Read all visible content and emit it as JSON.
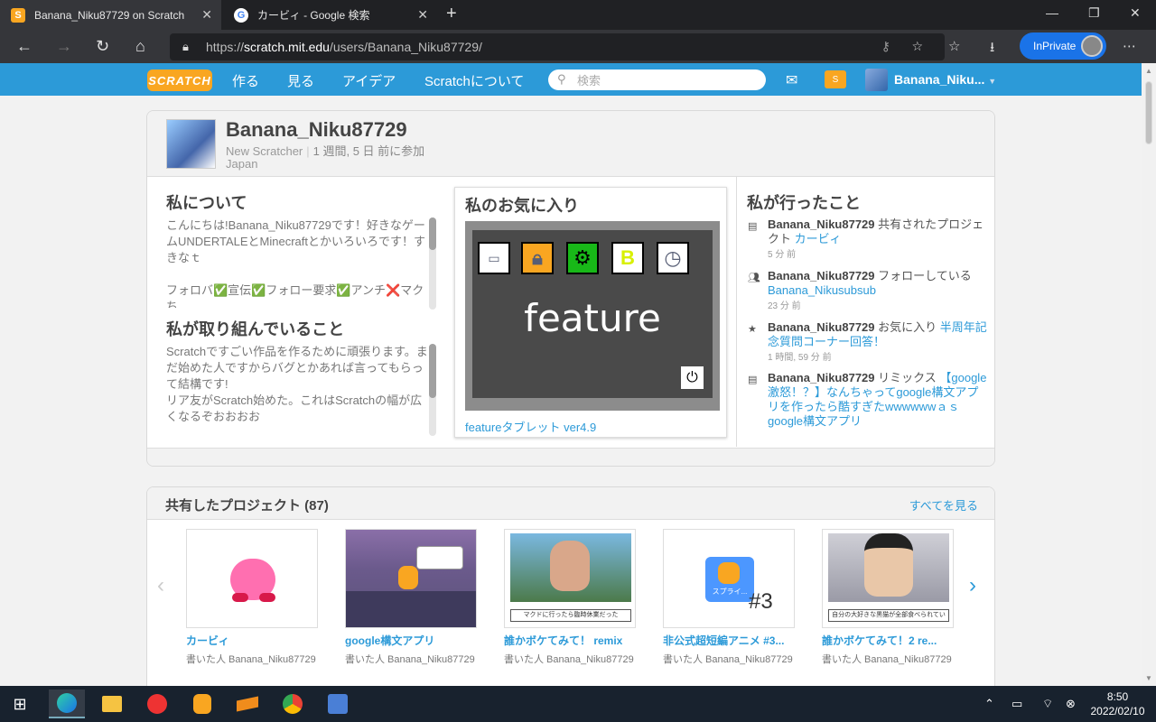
{
  "browser": {
    "tabs": [
      {
        "title": "Banana_Niku87729 on Scratch",
        "active": true
      },
      {
        "title": "カービィ - Google 検索",
        "active": false
      }
    ],
    "url_prefix": "https://",
    "url_host": "scratch.mit.edu",
    "url_path": "/users/Banana_Niku87729/",
    "inprivate_label": "InPrivate"
  },
  "scratch_nav": {
    "logo": "SCRATCH",
    "items": [
      "作る",
      "見る",
      "アイデア",
      "Scratchについて"
    ],
    "search_placeholder": "検索",
    "username": "Banana_Niku..."
  },
  "profile": {
    "username": "Banana_Niku87729",
    "rank": "New Scratcher",
    "joined": "1 週間, 5 日 前に参加",
    "country": "Japan",
    "about_title": "私について",
    "about_text": "こんにちは!Banana_Niku87729です！好きなゲームUNDERTALEとMinecraftとかいろいろです！すきなｔ\n\nフォロバ✅宣伝✅フォロー要求✅アンチ❌マクち",
    "working_title": "私が取り組んでいること",
    "working_text": "Scratchですごい作品を作るために頑張ります。まだ始めた人ですからバグとかあれば言ってもらって結構です!\nリア友がScratch始めた。これはScratchの幅が広くなるぞおおおお",
    "featured_title": "私のお気に入り",
    "featured_stage_text": "feature",
    "featured_project": "featureタブレット ver4.9",
    "activity_title": "私が行ったこと",
    "activity": [
      {
        "icon": "share-icon",
        "user": "Banana_Niku87729",
        "action": "共有されたプロジェクト",
        "target": "カービィ",
        "time": "5 分 前"
      },
      {
        "icon": "follow-icon",
        "user": "Banana_Niku87729",
        "action": "フォローしている",
        "target": "Banana_Nikusubsub",
        "time": "23 分 前"
      },
      {
        "icon": "star-icon",
        "user": "Banana_Niku87729",
        "action": "お気に入り",
        "target": "半周年記念質問コーナー回答！",
        "time": "1 時間, 59 分 前"
      },
      {
        "icon": "remix-icon",
        "user": "Banana_Niku87729",
        "action": "リミックス",
        "target": "【google激怒！？】なんちゃってgoogle構文アプリを作ったら酷すぎたwwwwwwａｓ google構文アプリ",
        "time": ""
      }
    ]
  },
  "shared": {
    "title": "共有したプロジェクト (87)",
    "see_all": "すべてを見る",
    "projects": [
      {
        "title": "カービィ",
        "author": "書いた人 Banana_Niku87729"
      },
      {
        "title": "google構文アプリ",
        "author": "書いた人 Banana_Niku87729"
      },
      {
        "title": "誰かボケてみて！ remix",
        "author": "書いた人 Banana_Niku87729"
      },
      {
        "title": "非公式超短編アニメ #3...",
        "author": "書いた人 Banana_Niku87729"
      },
      {
        "title": "誰かボケてみて！2 re...",
        "author": "書いた人 Banana_Niku87729"
      }
    ],
    "thumb_captions": {
      "p3": "マクドに行ったら臨時休業だった",
      "p4_sprite": "スプライ...",
      "p4_number": "#3",
      "p5": "自分の大好きな黒猫が全部食べられていた"
    }
  },
  "taskbar": {
    "time": "8:50",
    "date": "2022/02/10"
  },
  "colors": {
    "scratch_blue": "#2c9ad8",
    "scratch_orange": "#f9a621",
    "browser_dark": "#202124"
  }
}
